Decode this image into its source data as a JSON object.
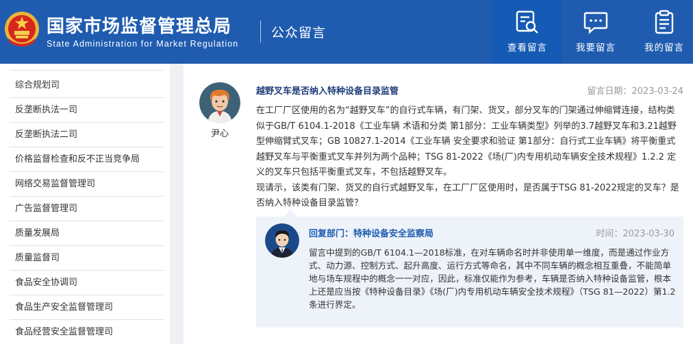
{
  "header": {
    "title_cn": "国家市场监督管理总局",
    "title_en": "State Administration for Market Regulation",
    "section": "公众留言",
    "nav": [
      {
        "label": "查看留言",
        "icon": "search-document-icon",
        "active": true
      },
      {
        "label": "我要留言",
        "icon": "chat-bubble-icon",
        "active": false
      },
      {
        "label": "我的留言",
        "icon": "clipboard-list-icon",
        "active": false
      }
    ]
  },
  "sidebar": {
    "items": [
      {
        "label": "综合规划司"
      },
      {
        "label": "反垄断执法一司"
      },
      {
        "label": "反垄断执法二司"
      },
      {
        "label": "价格监督检查和反不正当竞争局"
      },
      {
        "label": "网络交易监督管理司"
      },
      {
        "label": "广告监督管理司"
      },
      {
        "label": "质量发展局"
      },
      {
        "label": "质量监督司"
      },
      {
        "label": "食品安全协调司"
      },
      {
        "label": "食品生产安全监督管理司"
      },
      {
        "label": "食品经营安全监督管理司"
      }
    ]
  },
  "message": {
    "author": "尹心",
    "title": "越野叉车是否纳入特种设备目录监管",
    "date_label": "留言日期：",
    "date": "2023-03-24",
    "body_p1": "在工厂厂区使用的名为“越野叉车”的自行式车辆，有门架、货叉，部分叉车的门架通过伸缩臂连接，结构类似于GB/T 6104.1-2018《工业车辆 术语和分类 第1部分：工业车辆类型》列举的3.7越野叉车和3.21越野型伸缩臂式叉车；GB 10827.1-2014《工业车辆 安全要求和验证 第1部分：自行式工业车辆》将平衡重式越野叉车与平衡重式叉车并列为两个品种；TSG 81-2022《场(厂)内专用机动车辆安全技术规程》1.2.2 定义的叉车只包括平衡重式叉车，不包括越野叉车。",
    "body_p2": "现请示，该类有门架、货叉的自行式越野叉车，在工厂厂区使用时，是否属于TSG 81-2022规定的叉车？是否纳入特种设备目录监管？"
  },
  "reply": {
    "dept_label": "回复部门：",
    "dept": "特种设备安全监察局",
    "date_label": "时间：",
    "date": "2023-03-30",
    "body": "留言中提到的GB/T 6104.1—2018标准，在对车辆命名时并非使用单一维度，而是通过作业方式、动力源、控制方式、起升高度、运行方式等命名，其中不同车辆的概念相互重叠，不能简单地与场车规程中的概念一一对应，因此，标准仅能作为参考，车辆是否纳入特种设备监管，根本上还是应当按《特种设备目录》《场(厂)内专用机动车辆安全技术规程》（TSG 81—2022）第1.2条进行界定。"
  },
  "colors": {
    "brand_blue": "#1f5cb0",
    "reply_bg": "#eef3fa",
    "title_blue": "#1f3e7a"
  }
}
